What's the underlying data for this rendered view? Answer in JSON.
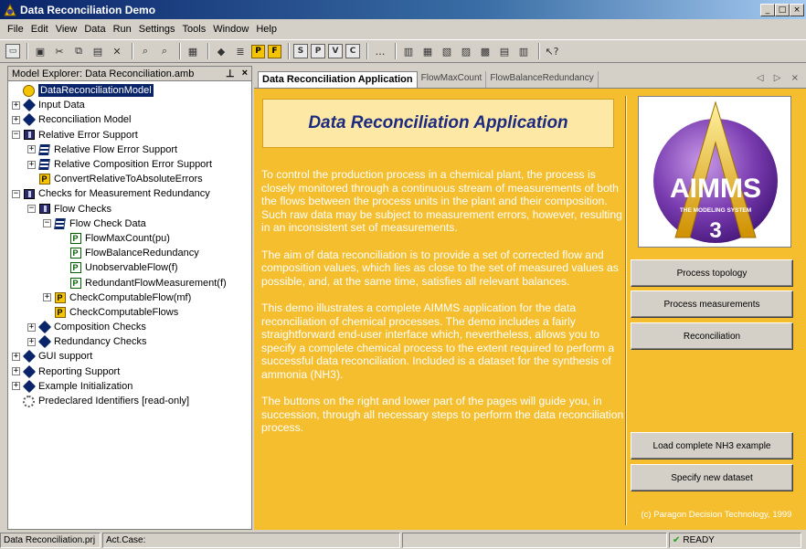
{
  "window": {
    "title": "Data Reconciliation Demo",
    "controls": [
      "_",
      "□",
      "×"
    ]
  },
  "menu": [
    "File",
    "Edit",
    "View",
    "Data",
    "Run",
    "Settings",
    "Tools",
    "Window",
    "Help"
  ],
  "explorer": {
    "title": "Model Explorer: Data Reconciliation.amb",
    "pin_label": "⊥",
    "close_label": "×",
    "tree": [
      {
        "label": "DataReconciliationModel",
        "depth": 0,
        "icon": "model-icon",
        "expander": "",
        "selected": true
      },
      {
        "label": "Input Data",
        "depth": 0,
        "icon": "section-icon",
        "expander": "+"
      },
      {
        "label": "Reconciliation Model",
        "depth": 0,
        "icon": "section-icon",
        "expander": "+"
      },
      {
        "label": "Relative Error Support",
        "depth": 0,
        "icon": "book-icon",
        "expander": "-"
      },
      {
        "label": "Relative Flow Error Support",
        "depth": 1,
        "icon": "declaration-icon",
        "expander": "+"
      },
      {
        "label": "Relative Composition Error Support",
        "depth": 1,
        "icon": "declaration-icon",
        "expander": "+"
      },
      {
        "label": "ConvertRelativeToAbsoluteErrors",
        "depth": 1,
        "icon": "procedure-icon",
        "expander": ""
      },
      {
        "label": "Checks for Measurement Redundancy",
        "depth": 0,
        "icon": "book-icon",
        "expander": "-"
      },
      {
        "label": "Flow Checks",
        "depth": 1,
        "icon": "book-icon",
        "expander": "-"
      },
      {
        "label": "Flow Check Data",
        "depth": 2,
        "icon": "declaration-icon",
        "expander": "-"
      },
      {
        "label": "FlowMaxCount(pu)",
        "depth": 3,
        "icon": "parameter-icon",
        "expander": ""
      },
      {
        "label": "FlowBalanceRedundancy",
        "depth": 3,
        "icon": "parameter-icon",
        "expander": ""
      },
      {
        "label": "UnobservableFlow(f)",
        "depth": 3,
        "icon": "parameter-icon",
        "expander": ""
      },
      {
        "label": "RedundantFlowMeasurement(f)",
        "depth": 3,
        "icon": "parameter-icon",
        "expander": ""
      },
      {
        "label": "CheckComputableFlow(mf)",
        "depth": 2,
        "icon": "procedure-icon",
        "expander": "+"
      },
      {
        "label": "CheckComputableFlows",
        "depth": 2,
        "icon": "procedure-icon",
        "expander": ""
      },
      {
        "label": "Composition Checks",
        "depth": 1,
        "icon": "section-icon",
        "expander": "+"
      },
      {
        "label": "Redundancy Checks",
        "depth": 1,
        "icon": "section-icon",
        "expander": "+"
      },
      {
        "label": "GUI support",
        "depth": 0,
        "icon": "section-icon",
        "expander": "+"
      },
      {
        "label": "Reporting Support",
        "depth": 0,
        "icon": "section-icon",
        "expander": "+"
      },
      {
        "label": "Example Initialization",
        "depth": 0,
        "icon": "section-icon",
        "expander": "+"
      },
      {
        "label": "Predeclared Identifiers [read-only]",
        "depth": 0,
        "icon": "gears-icon",
        "expander": ""
      }
    ]
  },
  "tabs": [
    {
      "label": "Data Reconciliation Application",
      "active": true
    },
    {
      "label": "FlowMaxCount",
      "active": false
    },
    {
      "label": "FlowBalanceRedundancy",
      "active": false
    }
  ],
  "tab_nav": "◁ ▷ ×",
  "page": {
    "heading": "Data Reconciliation Application",
    "paragraphs": [
      "To control the production process in a chemical plant, the process is closely monitored through a continuous stream of measurements of both the flows between the process units in the plant and their composition. Such raw data may be subject to measurement errors, however, resulting in an inconsistent set of measurements.",
      "The aim of data reconciliation is to provide a set of corrected flow and composition values, which lies as close to the set of measured values as possible, and, at the same time, satisfies all relevant balances.",
      "This demo illustrates a complete AIMMS application for the data reconciliation of chemical processes. The demo includes a fairly straightforward end-user interface which, nevertheless, allows you to specify a complete chemical process to the extent required to perform a successful data reconciliation. Included is a dataset for the synthesis of ammonia (NH3).",
      "The buttons on the right and lower part of the pages will guide you, in succession, through all necessary steps to perform the data reconciliation process."
    ],
    "logo": {
      "brand": "AIMMS",
      "tagline": "THE MODELING SYSTEM",
      "version": "3"
    },
    "buttons": {
      "process_topology": "Process topology",
      "process_measurements": "Process measurements",
      "reconciliation": "Reconciliation",
      "load_example": "Load complete NH3 example",
      "specify_dataset": "Specify new dataset"
    },
    "copyright": "(c) Paragon Decision Technology, 1999"
  },
  "status": {
    "project": "Data Reconciliation.prj",
    "case": "Act.Case:",
    "ready": "READY"
  },
  "colors": {
    "page_background": "#f5be2e",
    "heading_box": "#fde8a6",
    "heading_text": "#1c2a80",
    "selection": "#0a246a"
  }
}
